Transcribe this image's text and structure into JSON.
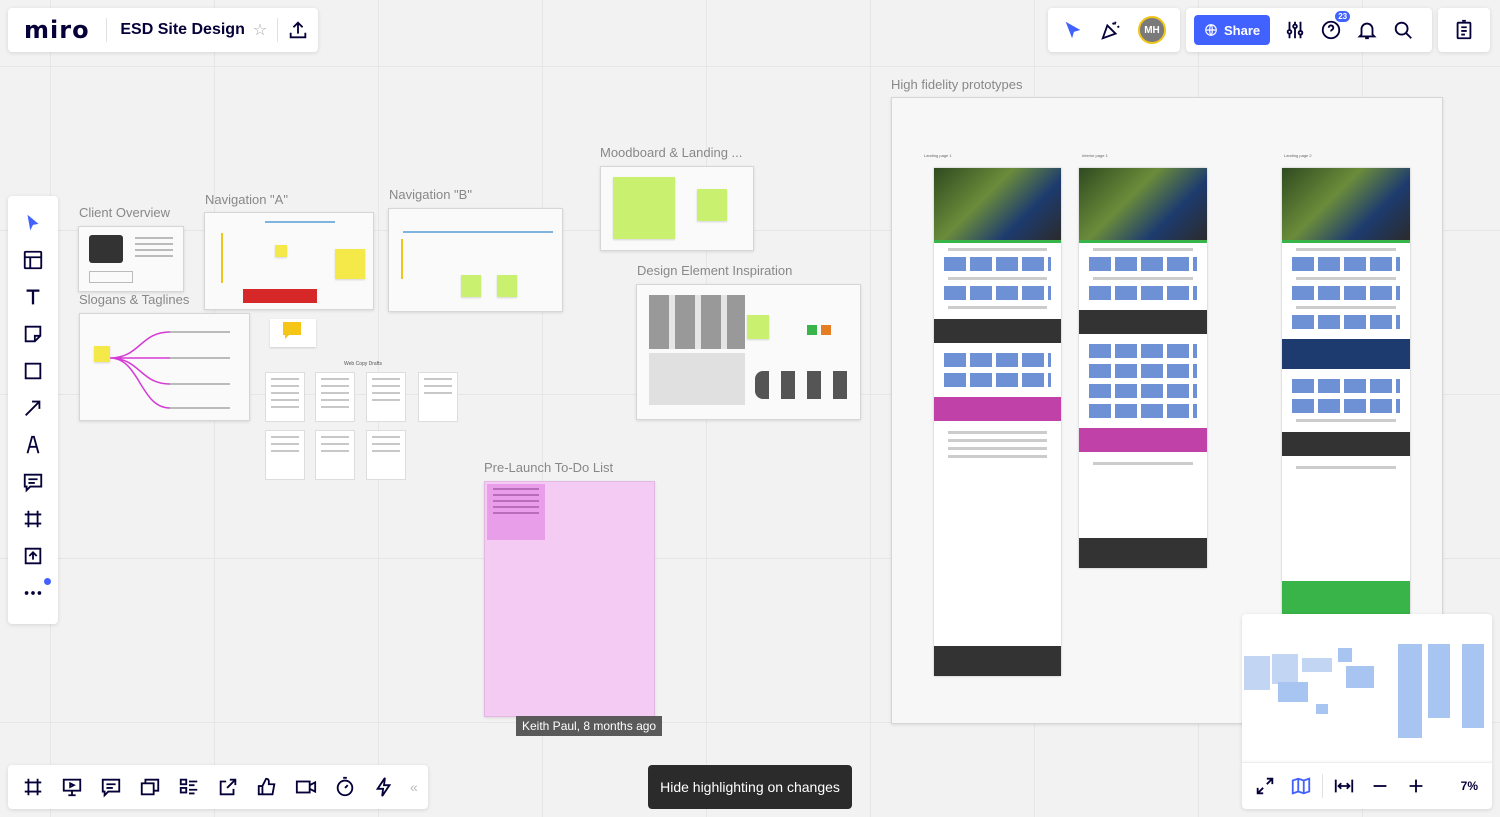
{
  "app": {
    "logo": "miro",
    "board_title": "ESD Site Design"
  },
  "header": {
    "avatar_initials": "MH",
    "share_label": "Share",
    "help_badge": "23"
  },
  "canvas": {
    "frames": [
      {
        "label": "Client Overview"
      },
      {
        "label": "Navigation \"A\""
      },
      {
        "label": "Navigation \"B\""
      },
      {
        "label": "Moodboard & Landing ..."
      },
      {
        "label": "Design Element Inspiration"
      },
      {
        "label": "Slogans & Taglines"
      },
      {
        "label": "Pre-Launch To-Do List"
      },
      {
        "label": "High fidelity prototypes"
      }
    ],
    "web_copy_label": "Web Copy Drafts",
    "prototype_pages": [
      "Landing page 1",
      "Interior page 1",
      "Landing page 2"
    ],
    "todo_tooltip": "Keith Paul, 8 months ago"
  },
  "toolbar_left": [
    "select-icon",
    "templates-icon",
    "text-icon",
    "sticky-note-icon",
    "shape-icon",
    "connector-icon",
    "pen-icon",
    "comment-icon",
    "frame-icon",
    "upload-icon",
    "more-icon"
  ],
  "toolbar_bottom": [
    "frames-icon",
    "presentation-icon",
    "comments-icon",
    "cards-icon",
    "kanban-icon",
    "export-icon",
    "voting-icon",
    "video-icon",
    "timer-icon",
    "apps-icon"
  ],
  "hide_highlight_label": "Hide highlighting on changes",
  "zoom": {
    "level": "7%"
  },
  "colors": {
    "accent": "#4262ff",
    "todo_frame": "#f3cbf3",
    "sticky_yellow": "#f5e94a",
    "sticky_green": "#c9f06e"
  }
}
